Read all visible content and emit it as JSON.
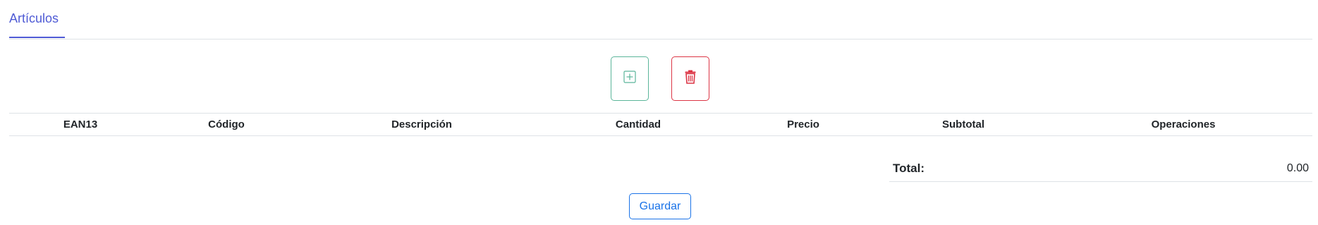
{
  "tabs": [
    {
      "label": "Artículos",
      "active": true
    }
  ],
  "toolbar": {
    "add_icon": "plus-square-icon",
    "delete_icon": "trash-icon"
  },
  "table": {
    "columns": [
      "EAN13",
      "Código",
      "Descripción",
      "Cantidad",
      "Precio",
      "Subtotal",
      "Operaciones"
    ],
    "rows": []
  },
  "totals": {
    "label": "Total:",
    "value": "0.00"
  },
  "actions": {
    "save_label": "Guardar"
  },
  "colors": {
    "accent": "#4f5bd5",
    "add_border": "#5bb59a",
    "delete": "#dc3545",
    "save": "#1a73e8"
  }
}
